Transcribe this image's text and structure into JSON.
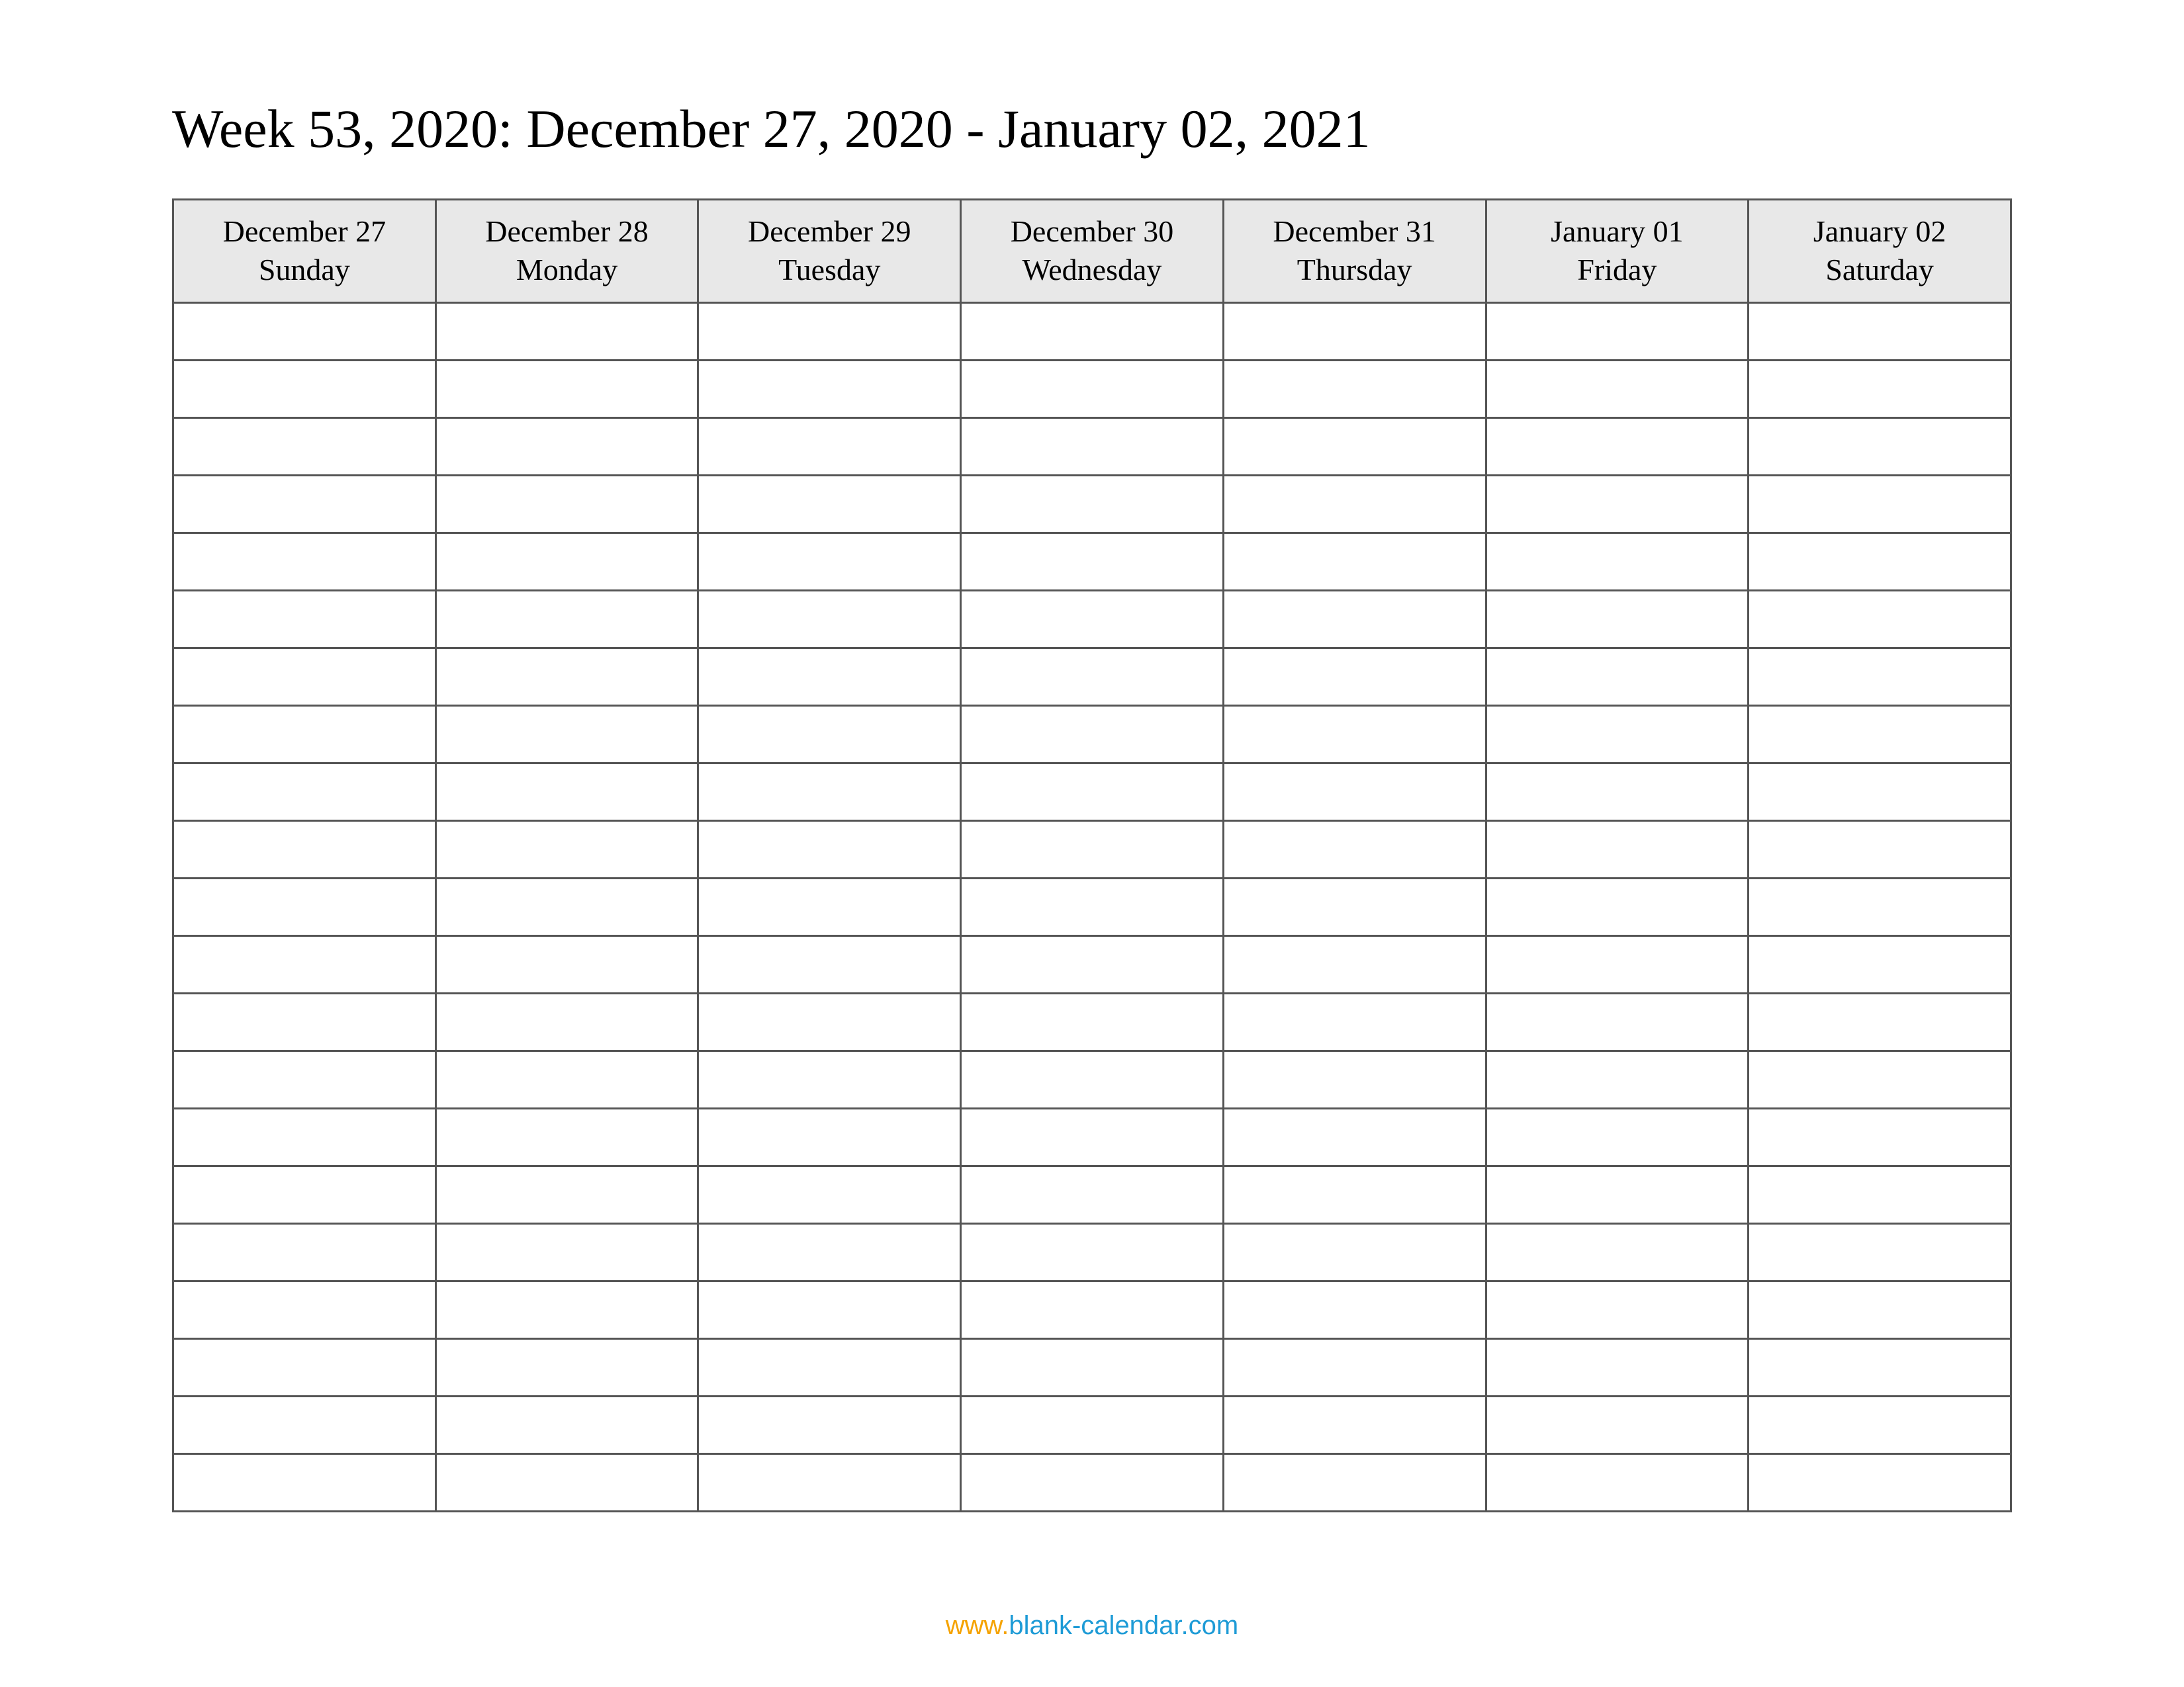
{
  "title": "Week 53, 2020: December 27, 2020 - January 02, 2021",
  "columns": [
    {
      "date": "December 27",
      "day": "Sunday"
    },
    {
      "date": "December 28",
      "day": "Monday"
    },
    {
      "date": "December 29",
      "day": "Tuesday"
    },
    {
      "date": "December 30",
      "day": "Wednesday"
    },
    {
      "date": "December 31",
      "day": "Thursday"
    },
    {
      "date": "January 01",
      "day": "Friday"
    },
    {
      "date": "January 02",
      "day": "Saturday"
    }
  ],
  "row_count": 21,
  "footer": {
    "prefix": "www.",
    "domain": "blank-calendar.com"
  },
  "colors": {
    "header_bg": "#e8e8e8",
    "border": "#555555",
    "footer_prefix": "#f5a300",
    "footer_domain": "#1e9bd6"
  }
}
